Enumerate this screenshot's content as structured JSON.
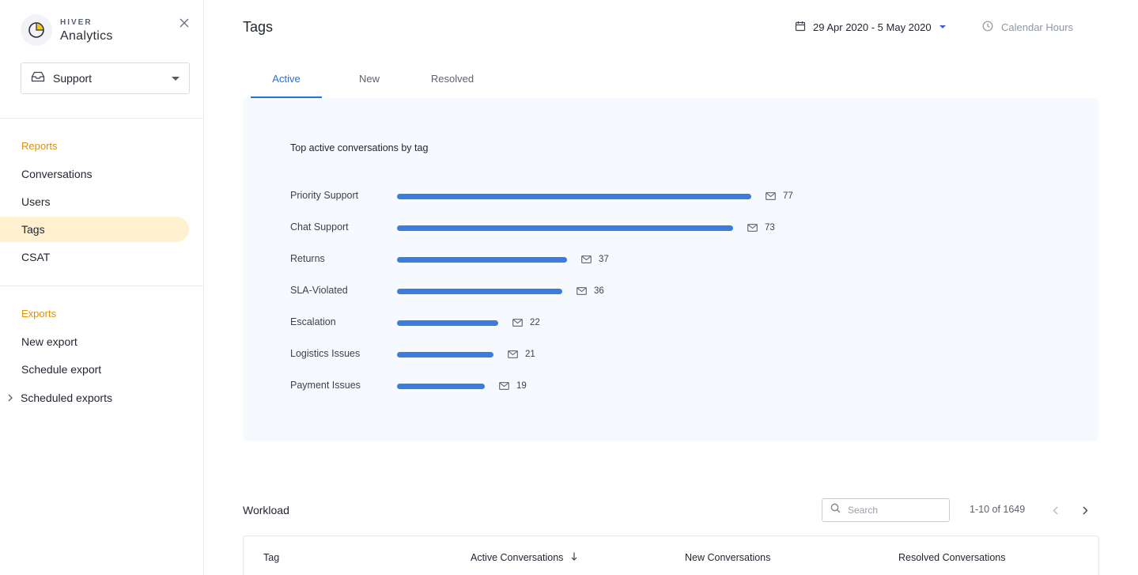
{
  "brand": {
    "small": "HIVER",
    "name": "Analytics"
  },
  "inbox_select": {
    "value": "Support"
  },
  "sidebar": {
    "reports_title": "Reports",
    "reports": [
      {
        "label": "Conversations"
      },
      {
        "label": "Users"
      },
      {
        "label": "Tags",
        "active": true
      },
      {
        "label": "CSAT"
      }
    ],
    "exports_title": "Exports",
    "exports": [
      {
        "label": "New export"
      },
      {
        "label": "Schedule export"
      },
      {
        "label": "Scheduled exports"
      }
    ]
  },
  "header": {
    "title": "Tags",
    "date_range": "29 Apr 2020 - 5 May 2020",
    "hours": "Calendar Hours"
  },
  "tabs": [
    {
      "label": "Active",
      "active": true
    },
    {
      "label": "New"
    },
    {
      "label": "Resolved"
    }
  ],
  "chart_data": {
    "type": "bar",
    "orientation": "horizontal",
    "title": "Top active conversations by tag",
    "categories": [
      "Priority Support",
      "Chat Support",
      "Returns",
      "SLA-Violated",
      "Escalation",
      "Logistics Issues",
      "Payment Issues"
    ],
    "values": [
      77,
      73,
      37,
      36,
      22,
      21,
      19
    ],
    "value_icon": "mail-icon",
    "bar_color": "#3b7ddd",
    "xlim": [
      0,
      77
    ],
    "grid": false
  },
  "workload": {
    "title": "Workload",
    "search_placeholder": "Search",
    "pager_text": "1-10 of 1649",
    "columns": [
      {
        "label": "Tag"
      },
      {
        "label": "Active Conversations",
        "sorted": "desc"
      },
      {
        "label": "New Conversations"
      },
      {
        "label": "Resolved Conversations"
      }
    ]
  },
  "colors": {
    "accent": "#2a6fd8",
    "section": "#e0900a",
    "active_nav": "#fff1d0"
  }
}
